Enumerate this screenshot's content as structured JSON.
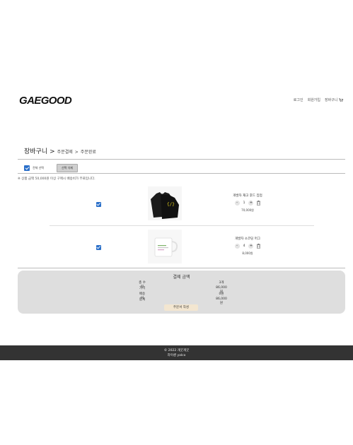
{
  "header": {
    "logo_text": "GAEGOOD",
    "nav": {
      "login": "로그인",
      "signup": "회원가입",
      "cart": "장바구니"
    }
  },
  "breadcrumb": {
    "current": "장바구니",
    "separator": ">",
    "step2": "주문결제",
    "step3": "주문완료"
  },
  "toolbar": {
    "select_all_label": "전체 선택",
    "delete_selected_label": "선택 삭제"
  },
  "notice": "※ 상품 금액 50,000원 이상 구매시 배송비가 무료입니다.",
  "items": [
    {
      "name": "개발자 재고 후드 집업",
      "quantity": "1",
      "price": "70,000원",
      "checked": true
    },
    {
      "name": "개발자 소코딩 머그",
      "quantity": "4",
      "price": "8,000원",
      "checked": true
    }
  ],
  "summary": {
    "title": "결제 금액",
    "rows": [
      {
        "label": "총 수량",
        "value": "3개"
      },
      {
        "label": "가격",
        "value": "86,000원"
      },
      {
        "label": "배송비",
        "value": "0원"
      },
      {
        "label": "합계",
        "value": "86,000원"
      }
    ],
    "order_button": "주문서 작성"
  },
  "footer": {
    "copyright": "© 2022 개굿개굿",
    "license": "라이센 yalco"
  },
  "colors": {
    "accent": "#2a6fc9",
    "order_button": "#f3e6d0",
    "footer_bg": "#333333",
    "summary_bg": "#dedede"
  }
}
